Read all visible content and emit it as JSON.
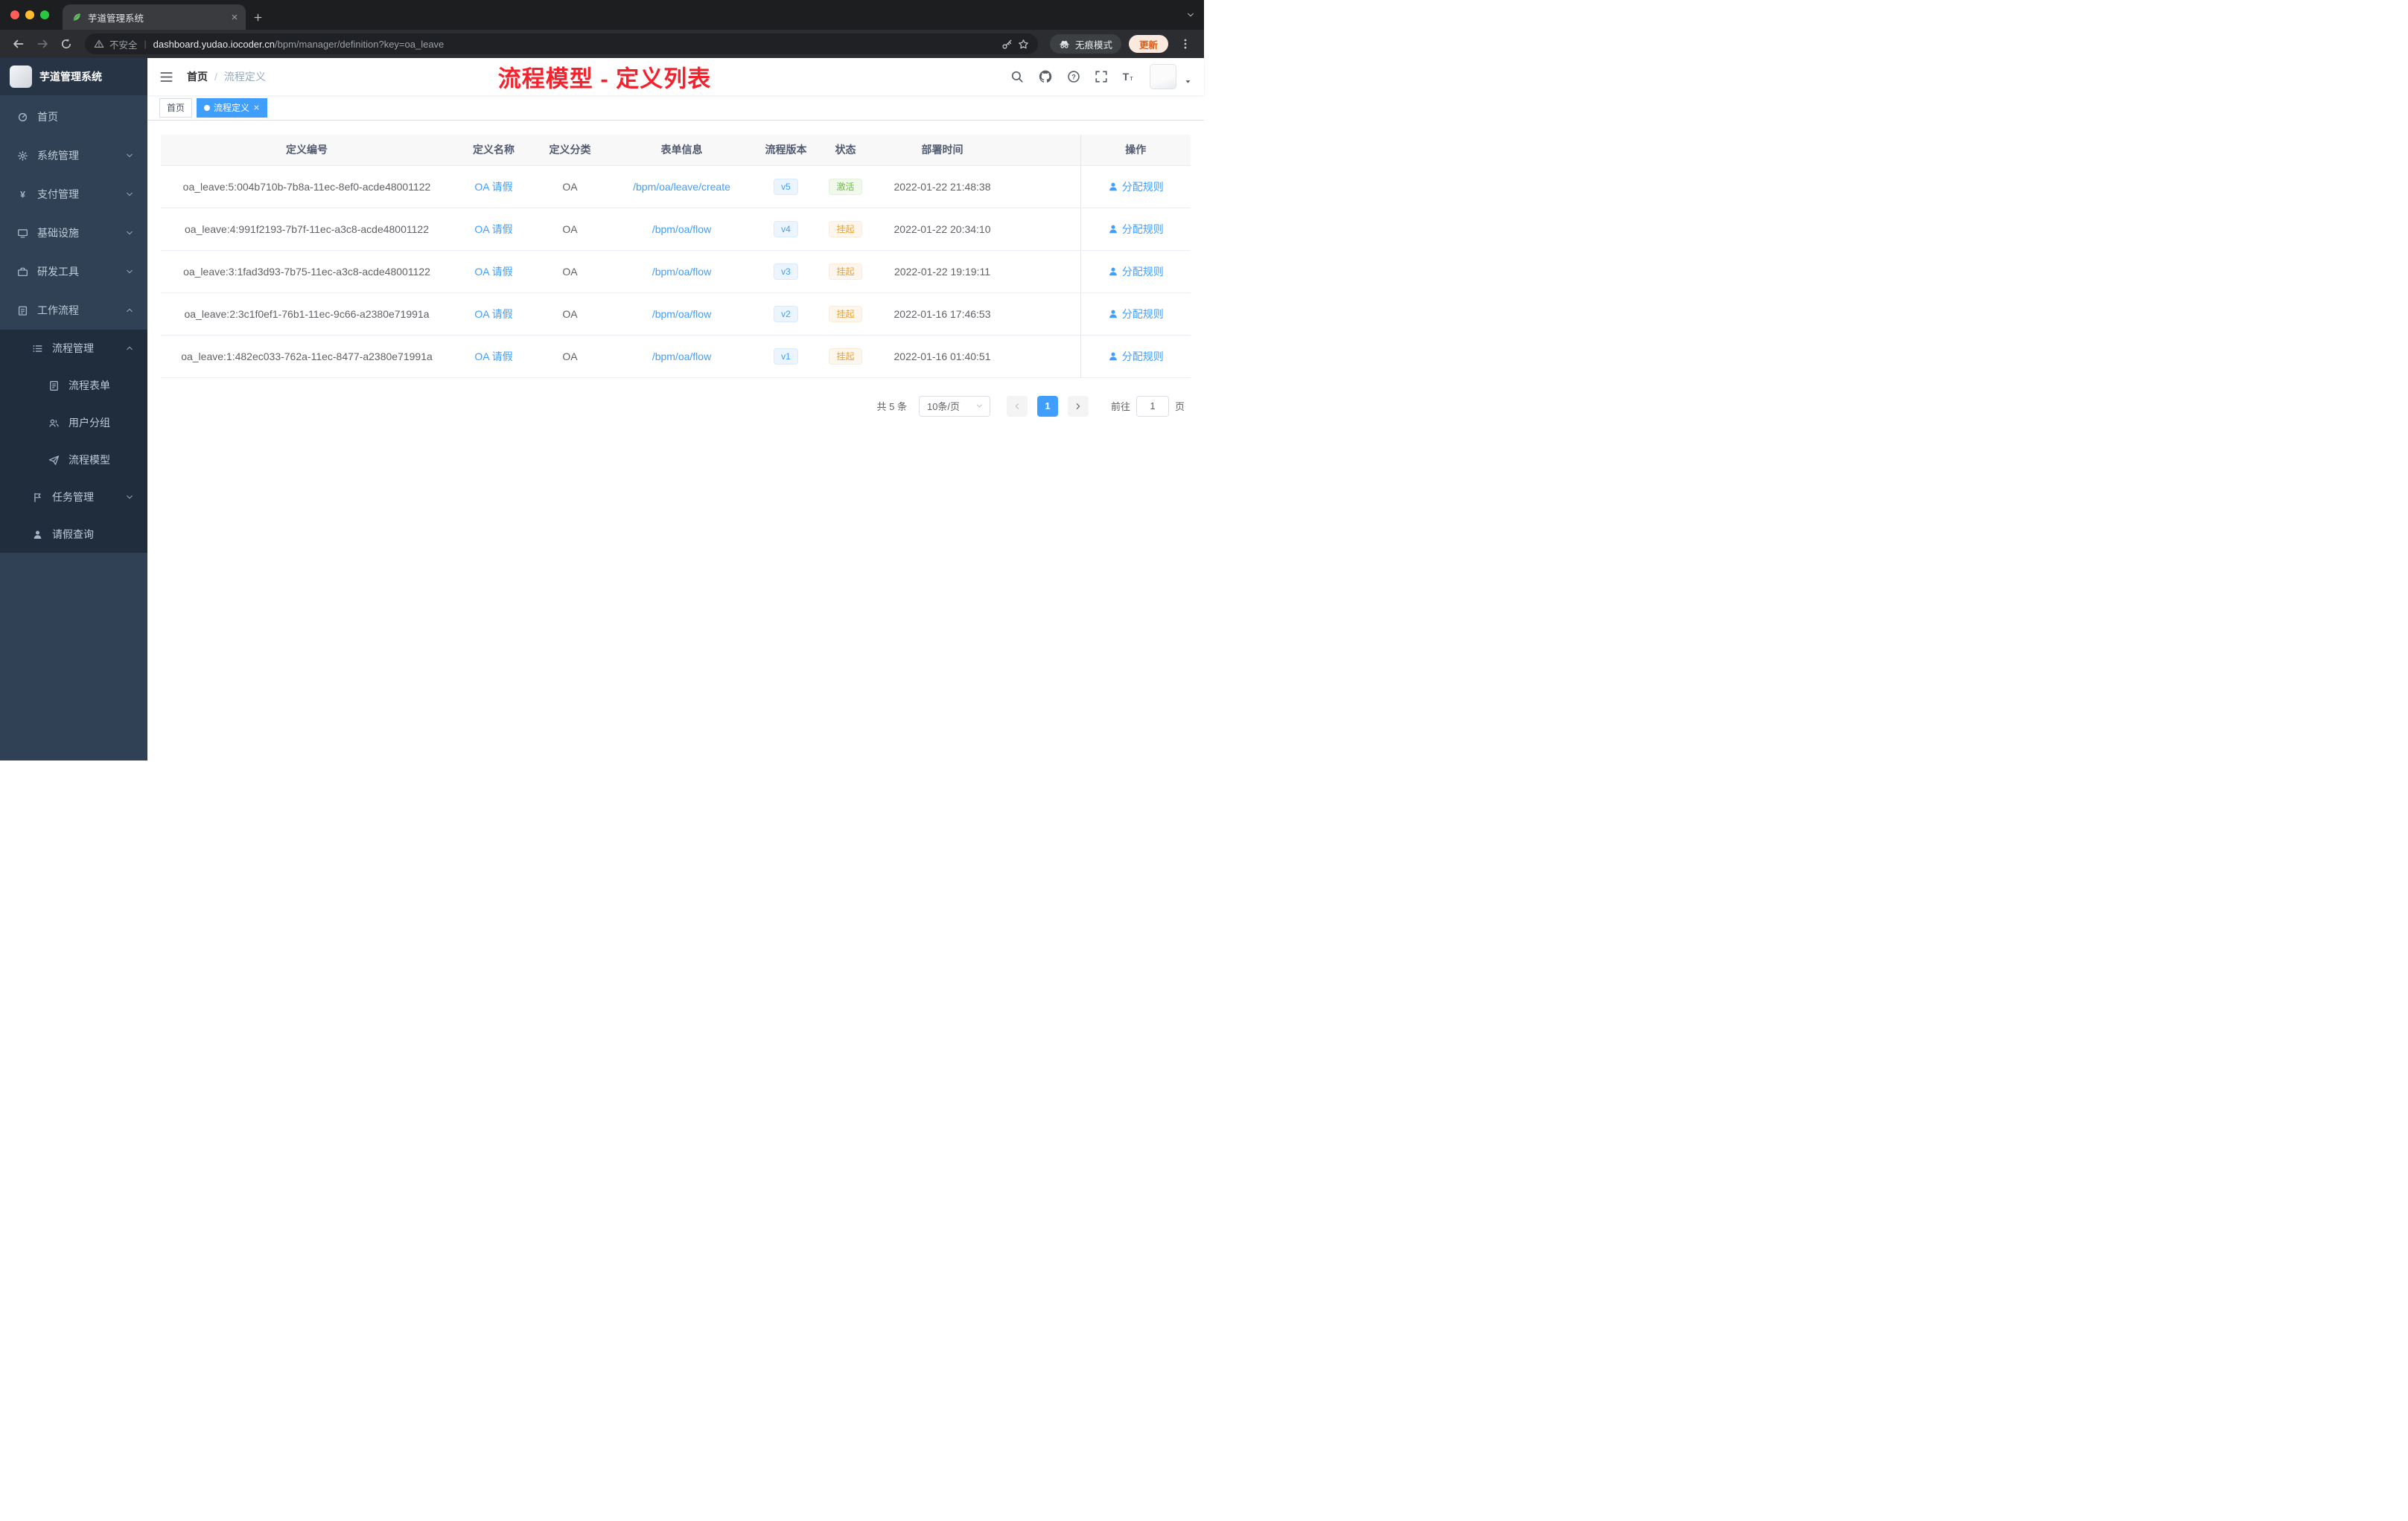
{
  "colors": {
    "primary": "#409eff",
    "success": "#67c23a",
    "warning": "#e6a23c",
    "annotation": "#f5222d",
    "sidebar_bg": "#304156",
    "submenu_bg": "#1f2d3d"
  },
  "browser": {
    "tab_title": "芋道管理系统",
    "security_label": "不安全",
    "url_host": "dashboard.yudao.iocoder.cn",
    "url_path": "/bpm/manager/definition?key=oa_leave",
    "incognito_label": "无痕模式",
    "update_label": "更新"
  },
  "sidebar": {
    "app_title": "芋道管理系统",
    "items": [
      {
        "key": "home",
        "label": "首页",
        "icon": "dashboard-icon",
        "depth": 0
      },
      {
        "key": "system",
        "label": "系统管理",
        "icon": "gear-icon",
        "depth": 0,
        "chevron": "down"
      },
      {
        "key": "payment",
        "label": "支付管理",
        "icon": "yen-icon",
        "depth": 0,
        "chevron": "down"
      },
      {
        "key": "infrastructure",
        "label": "基础设施",
        "icon": "monitor-icon",
        "depth": 0,
        "chevron": "down"
      },
      {
        "key": "devtools",
        "label": "研发工具",
        "icon": "toolbox-icon",
        "depth": 0,
        "chevron": "down"
      },
      {
        "key": "workflow",
        "label": "工作流程",
        "icon": "clipboard-icon",
        "depth": 0,
        "chevron": "up"
      },
      {
        "key": "process-management",
        "label": "流程管理",
        "icon": "list-icon",
        "depth": 1,
        "chevron": "up",
        "submenu": true
      },
      {
        "key": "process-form",
        "label": "流程表单",
        "icon": "form-icon",
        "depth": 2,
        "submenu": true
      },
      {
        "key": "user-group",
        "label": "用户分组",
        "icon": "users-icon",
        "depth": 2,
        "submenu": true
      },
      {
        "key": "process-model",
        "label": "流程模型",
        "icon": "paper-plane-icon",
        "depth": 2,
        "submenu": true
      },
      {
        "key": "task-management",
        "label": "任务管理",
        "icon": "tasks-icon",
        "depth": 1,
        "chevron": "down",
        "submenu": true
      },
      {
        "key": "leave-query",
        "label": "请假查询",
        "icon": "user-icon",
        "depth": 1,
        "submenu": true
      }
    ]
  },
  "header": {
    "breadcrumb": {
      "items": [
        "首页",
        "流程定义"
      ],
      "separator": "/"
    },
    "annotation": "流程模型 - 定义列表"
  },
  "tags": [
    {
      "label": "首页",
      "active": false
    },
    {
      "label": "流程定义",
      "active": true
    }
  ],
  "table": {
    "columns": [
      "定义编号",
      "定义名称",
      "定义分类",
      "表单信息",
      "流程版本",
      "状态",
      "部署时间",
      "操作"
    ],
    "rows": [
      {
        "id": "oa_leave:5:004b710b-7b8a-11ec-8ef0-acde48001122",
        "name": "OA 请假",
        "category": "OA",
        "form": "/bpm/oa/leave/create",
        "version": "v5",
        "status": "激活",
        "status_type": "success",
        "time": "2022-01-22 21:48:38",
        "action": "分配规则"
      },
      {
        "id": "oa_leave:4:991f2193-7b7f-11ec-a3c8-acde48001122",
        "name": "OA 请假",
        "category": "OA",
        "form": "/bpm/oa/flow",
        "version": "v4",
        "status": "挂起",
        "status_type": "warning",
        "time": "2022-01-22 20:34:10",
        "action": "分配规则"
      },
      {
        "id": "oa_leave:3:1fad3d93-7b75-11ec-a3c8-acde48001122",
        "name": "OA 请假",
        "category": "OA",
        "form": "/bpm/oa/flow",
        "version": "v3",
        "status": "挂起",
        "status_type": "warning",
        "time": "2022-01-22 19:19:11",
        "action": "分配规则"
      },
      {
        "id": "oa_leave:2:3c1f0ef1-76b1-11ec-9c66-a2380e71991a",
        "name": "OA 请假",
        "category": "OA",
        "form": "/bpm/oa/flow",
        "version": "v2",
        "status": "挂起",
        "status_type": "warning",
        "time": "2022-01-16 17:46:53",
        "action": "分配规则"
      },
      {
        "id": "oa_leave:1:482ec033-762a-11ec-8477-a2380e71991a",
        "name": "OA 请假",
        "category": "OA",
        "form": "/bpm/oa/flow",
        "version": "v1",
        "status": "挂起",
        "status_type": "warning",
        "time": "2022-01-16 01:40:51",
        "action": "分配规则"
      }
    ]
  },
  "pagination": {
    "total_label": "共 5 条",
    "page_size_label": "10条/页",
    "current_page": "1",
    "jump_prefix": "前往",
    "jump_suffix": "页",
    "jump_value": "1"
  }
}
